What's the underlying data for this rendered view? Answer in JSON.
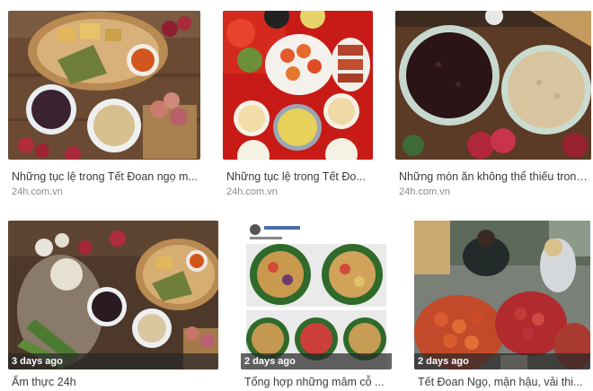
{
  "results": [
    {
      "title": "Những tục lệ trong Tết Đoan ngọ m...",
      "source": "24h.com.vn",
      "age": ""
    },
    {
      "title": "Những tục lệ trong Tết Đo...",
      "source": "24h.com.vn",
      "age": ""
    },
    {
      "title": "Những món ăn không thể thiếu trong n...",
      "source": "24h.com.vn",
      "age": ""
    },
    {
      "title": "Ẩm thực 24h",
      "source": "",
      "age": "3 days ago"
    },
    {
      "title": "Tổng hợp những mâm cỗ ...",
      "source": "",
      "age": "2 days ago"
    },
    {
      "title": "Tết Đoan Ngọ, mận hậu, vải thi...",
      "source": "",
      "age": "2 days ago"
    }
  ],
  "thumbnails": [
    {
      "icon": "food-tray-image"
    },
    {
      "icon": "festival-spread-image"
    },
    {
      "icon": "black-rice-bowls-image"
    },
    {
      "icon": "fruits-and-herbs-image"
    },
    {
      "icon": "social-post-collage-image"
    },
    {
      "icon": "market-lychee-image"
    }
  ],
  "colors": {
    "badge": "#282828",
    "title": "#3c3c3c",
    "source": "#8a8a8a"
  }
}
